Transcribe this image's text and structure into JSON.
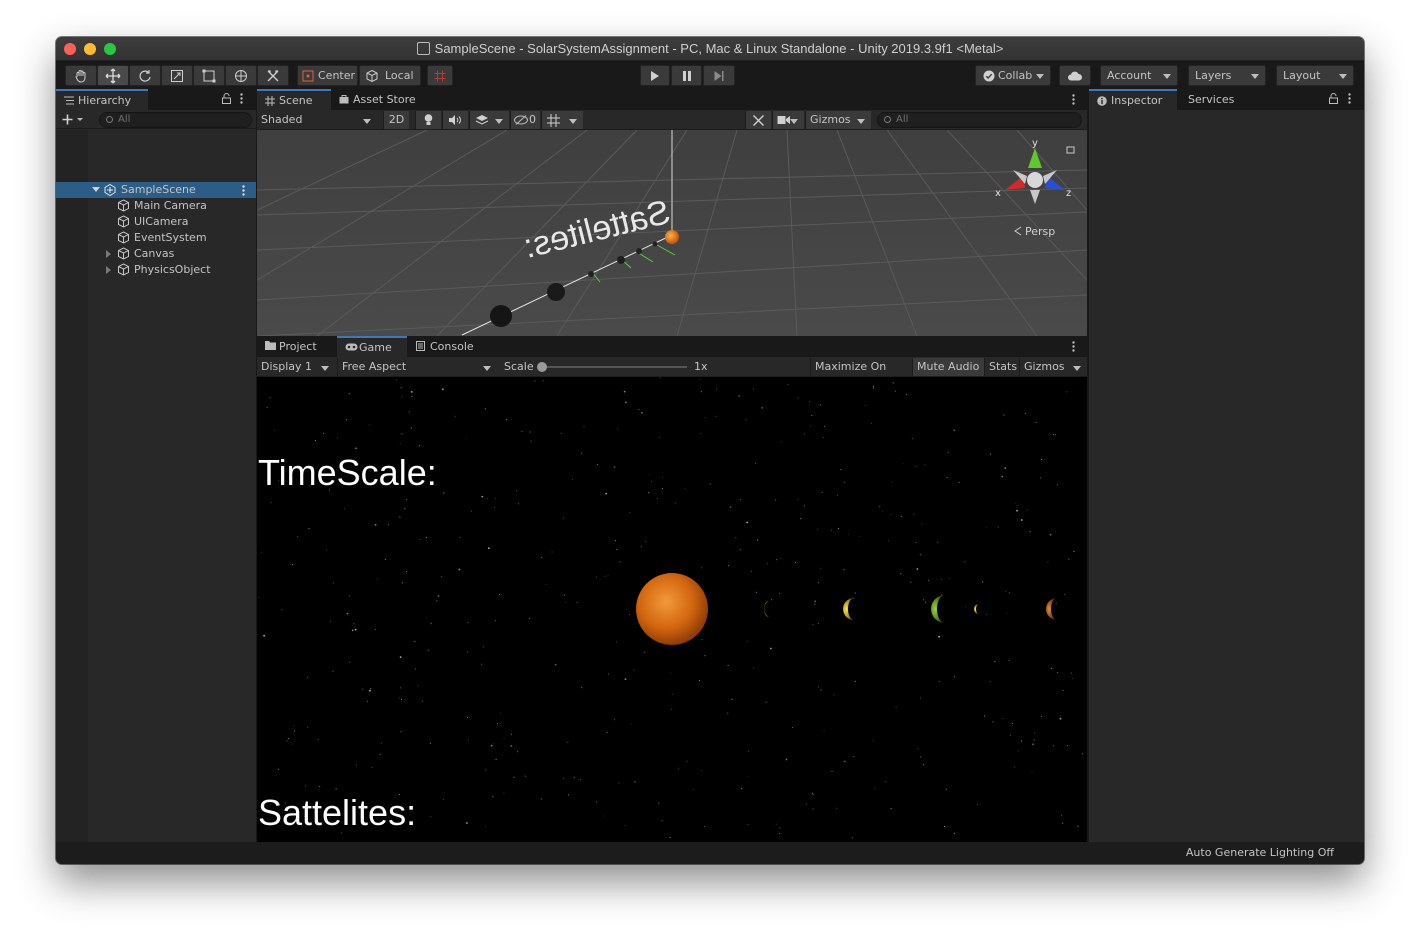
{
  "window": {
    "title": "SampleScene - SolarSystemAssignment - PC, Mac & Linux Standalone - Unity 2019.3.9f1 <Metal>"
  },
  "toolbar": {
    "tools": [
      "hand-tool",
      "move-tool",
      "rotate-tool",
      "scale-tool",
      "rect-tool",
      "transform-tool",
      "custom-tool"
    ],
    "pivot_label": "Center",
    "space_label": "Local",
    "collab_label": "Collab",
    "account_label": "Account",
    "layers_label": "Layers",
    "layout_label": "Layout"
  },
  "hierarchy": {
    "tab_label": "Hierarchy",
    "search_placeholder": "All",
    "scene_name": "SampleScene",
    "items": [
      {
        "label": "Main Camera",
        "expandable": false
      },
      {
        "label": "UICamera",
        "expandable": false
      },
      {
        "label": "EventSystem",
        "expandable": false
      },
      {
        "label": "Canvas",
        "expandable": true
      },
      {
        "label": "PhysicsObject",
        "expandable": true
      }
    ]
  },
  "scene_view": {
    "tabs": [
      "Scene",
      "Asset Store"
    ],
    "shading_mode": "Shaded",
    "mode_2d_label": "2D",
    "hidden_count": "0",
    "gizmos_label": "Gizmos",
    "search_placeholder": "All",
    "projection_label": "Persp",
    "axis_labels": {
      "x": "x",
      "y": "y",
      "z": "z"
    },
    "world_text": "Sattelites:"
  },
  "game_view": {
    "tabs": [
      "Project",
      "Game",
      "Console"
    ],
    "display_label": "Display 1",
    "aspect_label": "Free Aspect",
    "scale_label": "Scale",
    "scale_value": "1x",
    "maximize_label": "Maximize On Play",
    "mute_label": "Mute Audio",
    "stats_label": "Stats",
    "gizmos_label": "Gizmos",
    "timescale_text": "TimeScale:",
    "satellites_text": "Sattelites:"
  },
  "inspector": {
    "tab_label": "Inspector",
    "services_label": "Services"
  },
  "status": {
    "lighting_text": "Auto Generate Lighting Off"
  },
  "colors": {
    "accent": "#3a79bb",
    "sun": "#e07a1a",
    "axis_x": "#d22a2a",
    "axis_y": "#5ec92a",
    "axis_z": "#2a4fd6"
  }
}
